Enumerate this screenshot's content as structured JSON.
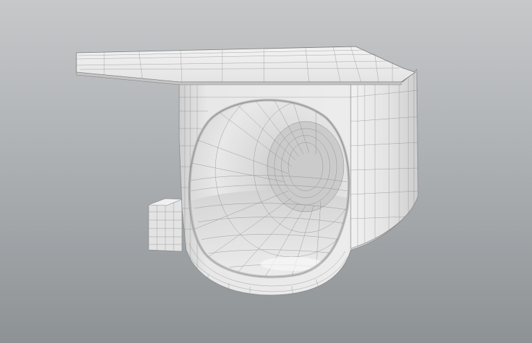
{
  "viewport": {
    "background_top": "#c6c8ca",
    "background_bottom": "#8c9194",
    "model_surface": "#e6e6e6",
    "model_shadow": "#b9b9b9",
    "wireframe_color": "#6e6e6e"
  },
  "model": {
    "kind": "wireframe-mesh-bracket",
    "parts": [
      "top-plate",
      "tube-body",
      "tube-opening",
      "side-tab"
    ]
  }
}
